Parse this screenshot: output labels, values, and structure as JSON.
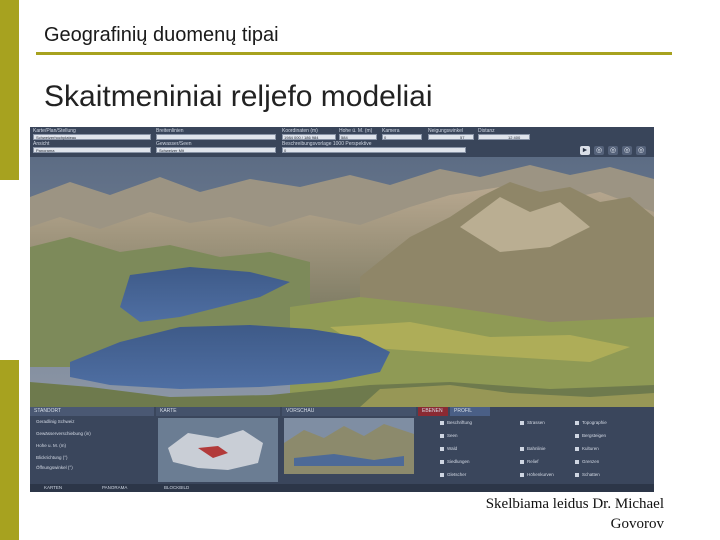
{
  "slide": {
    "header": "Geografinių duomenų tipai",
    "title": "Skaitmeniniai reljefo modeliai",
    "credit_line1": "Skelbiama leidus Dr. Michael",
    "credit_line2": "Govorov"
  },
  "app": {
    "top_fields": [
      {
        "label": "Karte/Plan/Stellung",
        "value": "Schweizerhochplateau"
      },
      {
        "label": "Breitenlinien",
        "value": ""
      },
      {
        "label": "Koordinaten (m)",
        "value": "1984 000 / 186 984"
      },
      {
        "label": "Hohe ü. M. (m)",
        "value": "584"
      },
      {
        "label": "Kamera",
        "value": "0"
      },
      {
        "label": "Neigungswinkel",
        "value": "57"
      },
      {
        "label": "Distanz",
        "value": "12 400"
      }
    ],
    "second_fields": [
      {
        "label": "Ansicht",
        "value": "Panorama"
      },
      {
        "label": "Gewasser/Seen",
        "value": "Schweizer Mit"
      },
      {
        "label": "Beschreibungsvorlage 1000 Perspektive",
        "value": "0"
      }
    ],
    "controls": [
      "►",
      "◎",
      "◎",
      "◎",
      "◎"
    ],
    "panel_tabs": [
      "STANDORT",
      "KARTE",
      "VORSCHAU",
      "EBENEN",
      "PROFIL"
    ],
    "panel_left_items": [
      "Geradlinig Schweiz",
      "Gewässerverschiebung (in)",
      "Hohe u. M. (m)",
      "Blickrichtung (°)",
      "Öffnungswinkel (°)"
    ],
    "panel_layers_a": [
      "Beschriftung",
      "Seen",
      "Wald",
      "Siedlungen",
      "Gletscher"
    ],
    "panel_layers_b": [
      "Strassen",
      "",
      "Bahnlinie",
      "Relief",
      "Höhenkurven"
    ],
    "panel_layers_c": [
      "Topographie",
      "Bergsteigen",
      "Kulturen",
      "Grenzen",
      "Schatten"
    ],
    "bottom_tabs": [
      "KARTEN",
      "PANORAMA",
      "BLOCKBILD"
    ]
  }
}
